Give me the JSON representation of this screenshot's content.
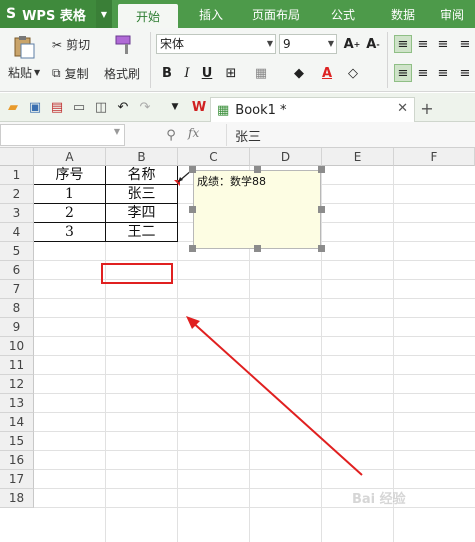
{
  "app": {
    "name": "WPS 表格"
  },
  "menu_tabs": [
    {
      "label": "开始",
      "active": true
    },
    {
      "label": "插入"
    },
    {
      "label": "页面布局"
    },
    {
      "label": "公式"
    },
    {
      "label": "数据"
    },
    {
      "label": "审阅"
    }
  ],
  "ribbon": {
    "paste": "粘贴",
    "cut": "剪切",
    "copy": "复制",
    "format_painter": "格式刷",
    "font_name": "宋体",
    "font_size": "9"
  },
  "document_tab": {
    "title": "Book1 *"
  },
  "formula_bar": {
    "fx": "fx",
    "value": "张三"
  },
  "columns": [
    "A",
    "B",
    "C",
    "D",
    "E",
    "F"
  ],
  "rows": [
    "1",
    "2",
    "3",
    "4",
    "5",
    "6",
    "7",
    "8",
    "9",
    "10",
    "11",
    "12",
    "13",
    "14",
    "15",
    "16",
    "17",
    "18"
  ],
  "cells": {
    "A1": "序号",
    "B1": "名称",
    "A2": "1",
    "B2": "张三",
    "A3": "2",
    "B3": "李四",
    "A4": "3",
    "B4": "王二"
  },
  "comment": {
    "text": "成绩：数学88"
  },
  "watermark": "Bai 经验",
  "colors": {
    "accent": "#4d9a4a",
    "annotation": "#e02020",
    "comment_bg": "#fdfde3"
  }
}
